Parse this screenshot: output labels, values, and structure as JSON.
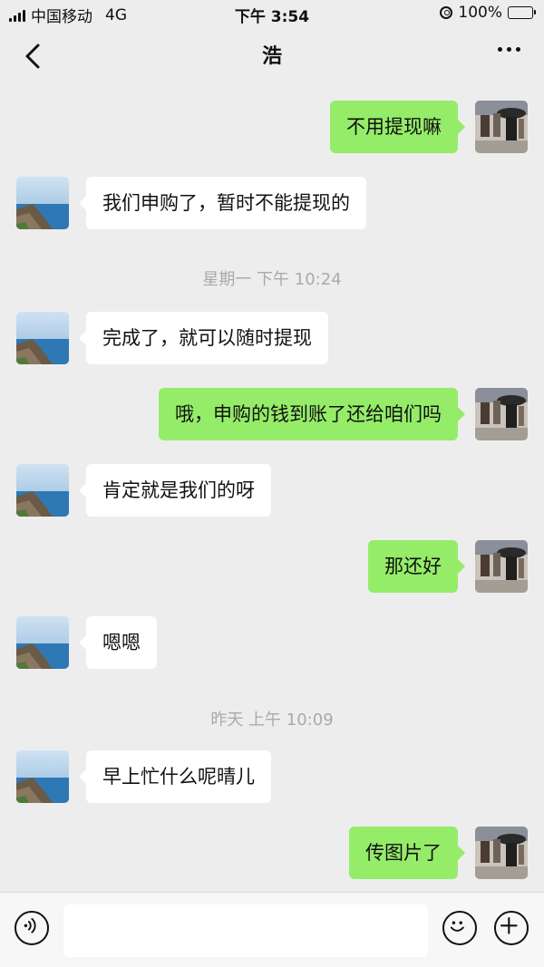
{
  "status_bar": {
    "carrier": "中国移动",
    "network": "4G",
    "time": "下午 3:54",
    "battery": "100%"
  },
  "header": {
    "title": "浩",
    "back_icon": "chevron-left-icon",
    "more_icon": "ellipsis-icon"
  },
  "messages": [
    {
      "side": "right",
      "text": "不用提现嘛"
    },
    {
      "side": "left",
      "text": "我们申购了，暂时不能提现的"
    },
    {
      "type": "time",
      "text": "星期一 下午 10:24"
    },
    {
      "side": "left",
      "text": "完成了，就可以随时提现"
    },
    {
      "side": "right",
      "text": "哦，申购的钱到账了还给咱们吗"
    },
    {
      "side": "left",
      "text": "肯定就是我们的呀"
    },
    {
      "side": "right",
      "text": "那还好"
    },
    {
      "side": "left",
      "text": "嗯嗯"
    },
    {
      "type": "time",
      "text": "昨天 上午 10:09"
    },
    {
      "side": "left",
      "text": "早上忙什么呢晴儿"
    },
    {
      "side": "right",
      "text": "传图片了"
    }
  ],
  "input_bar": {
    "voice_icon": "voice-icon",
    "emoji_icon": "emoji-icon",
    "plus_icon": "plus-icon",
    "input_value": ""
  },
  "colors": {
    "background": "#ededed",
    "sent_bubble": "#95ec69",
    "received_bubble": "#ffffff",
    "battery": "#2bd34a"
  }
}
